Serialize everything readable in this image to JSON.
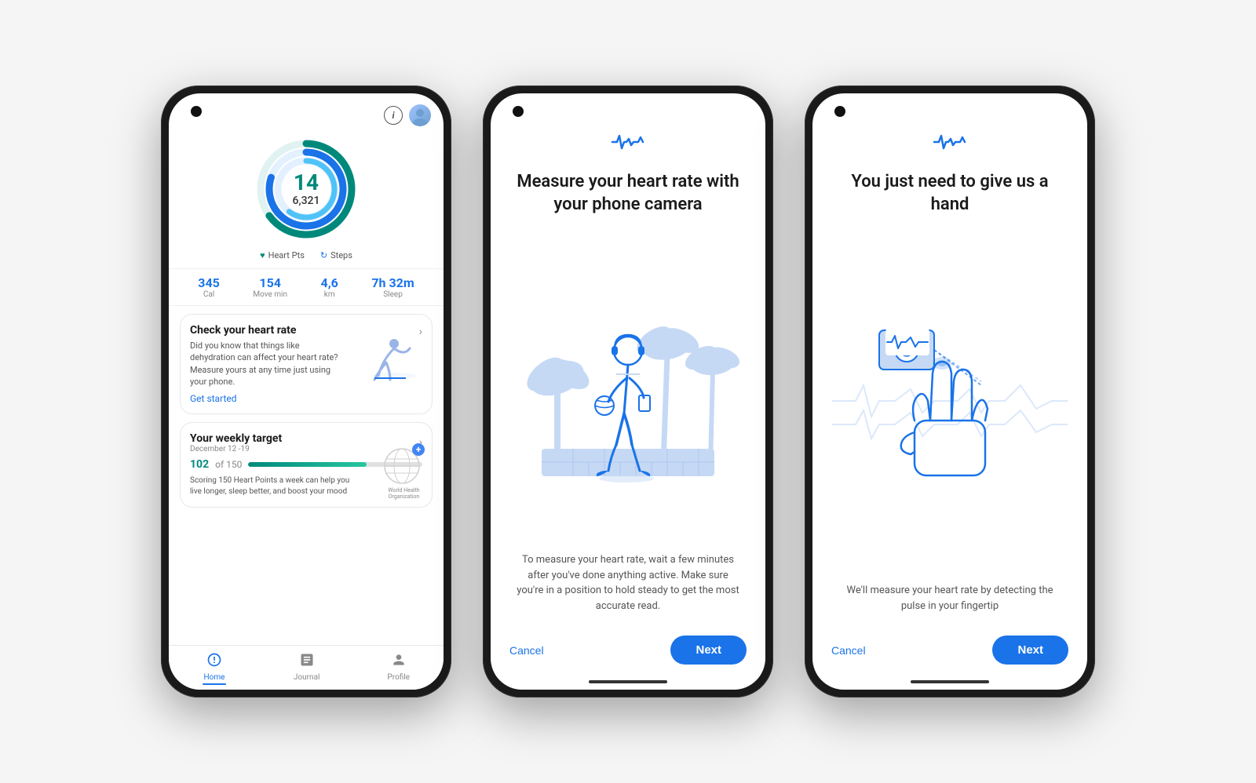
{
  "phone1": {
    "header": {
      "info_icon": "i",
      "avatar_label": "user avatar"
    },
    "ring": {
      "heart_pts": "14",
      "steps": "6,321",
      "outer_pct": 65,
      "inner_pct": 80
    },
    "labels": {
      "heart_pts": "Heart Pts",
      "steps": "Steps"
    },
    "stats": [
      {
        "value": "345",
        "label": "Cal"
      },
      {
        "value": "154",
        "label": "Move min"
      },
      {
        "value": "4,6",
        "label": "km"
      },
      {
        "value": "7h 32m",
        "label": "Sleep"
      }
    ],
    "heart_rate_card": {
      "title": "Check your heart rate",
      "desc": "Did you know that things like dehydration can affect your heart rate? Measure yours at any time just using your phone.",
      "link": "Get started"
    },
    "weekly_card": {
      "title": "Your weekly target",
      "date": "December 12 -19",
      "progress_value": "102",
      "progress_max": "of 150",
      "progress_pct": 68,
      "desc": "Scoring 150 Heart Points a week can help you live longer, sleep better, and boost your mood",
      "who_label": "World Health Organization"
    },
    "nav": [
      {
        "label": "Home",
        "active": true,
        "icon": "⊙"
      },
      {
        "label": "Journal",
        "active": false,
        "icon": "📋"
      },
      {
        "label": "Profile",
        "active": false,
        "icon": "👤"
      }
    ]
  },
  "phone2": {
    "heartwave": "〜",
    "title": "Measure your heart rate with your phone camera",
    "desc": "To measure your heart rate, wait a few minutes after you've done anything active. Make sure you're in a position to hold steady to get the most accurate read.",
    "cancel_label": "Cancel",
    "next_label": "Next"
  },
  "phone3": {
    "heartwave": "〜",
    "title": "You just need to give us a hand",
    "desc": "We'll measure your heart rate by detecting the pulse in your fingertip",
    "cancel_label": "Cancel",
    "next_label": "Next"
  },
  "colors": {
    "blue": "#1a73e8",
    "teal": "#00897b",
    "light_blue": "#c5d9f5",
    "mid_blue": "#5b8dd9"
  }
}
